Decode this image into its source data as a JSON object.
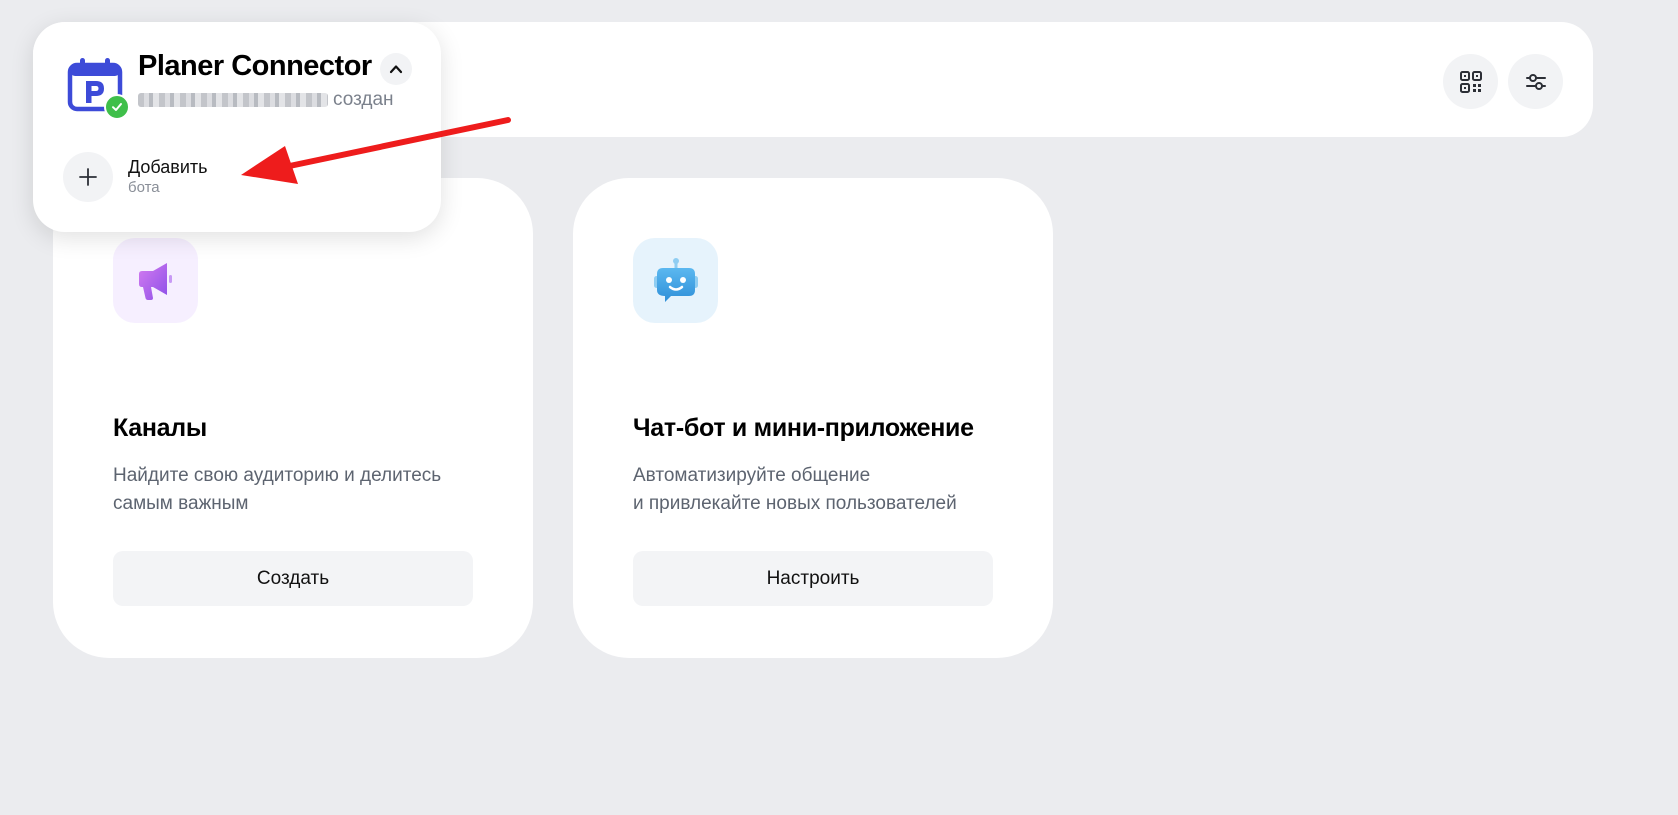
{
  "header": {
    "qr_icon": "qr-code-icon",
    "settings_icon": "sliders-icon"
  },
  "bot_selector": {
    "name": "Planer Connector",
    "status": "создан",
    "avatar_icon": "calendar-p-icon",
    "badge_icon": "check-icon",
    "collapse_icon": "chevron-up-icon",
    "add": {
      "label": "Добавить",
      "sublabel": "бота",
      "icon": "plus-icon"
    }
  },
  "cards": [
    {
      "title": "Каналы",
      "description": "Найдите свою аудиторию и делитесь\nсамым важным",
      "button": "Создать",
      "icon": "megaphone-icon"
    },
    {
      "title": "Чат-бот и мини-приложение",
      "description": "Автоматизируйте общение\nи привлекайте новых пользователей",
      "button": "Настроить",
      "icon": "robot-icon"
    }
  ],
  "colors": {
    "background": "#ebecef",
    "card": "#ffffff",
    "accent": "#3d4bd8",
    "badge": "#3fbf4a",
    "annotation_arrow": "#ee1c1c"
  }
}
